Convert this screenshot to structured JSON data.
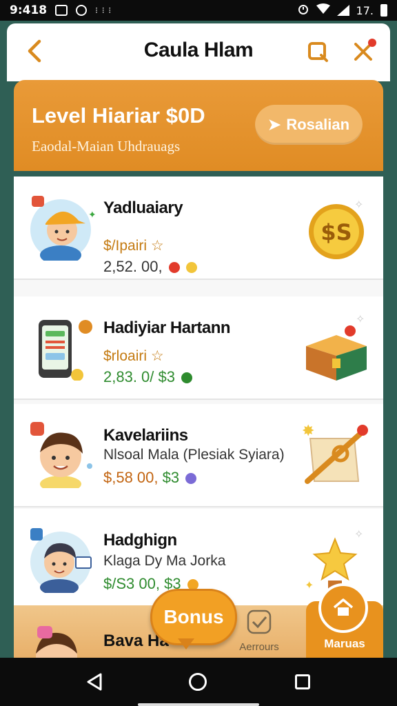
{
  "status_bar": {
    "time": "9:418",
    "dots": "⁝ ⁝ ⁝",
    "battery": "17."
  },
  "header": {
    "title": "Caula Hlam",
    "back_icon": "chevron-left-icon",
    "search_icon": "search-icon",
    "close_icon": "close-icon"
  },
  "banner": {
    "title": "Level Hiariar $0D",
    "subtitle": "Eaodal-Maian Uhdrauags",
    "button_label": "Rosalian"
  },
  "cards": [
    {
      "name": "Yadluaiary",
      "sub": "$/Ipairi ☆",
      "price": "2,52. 00,",
      "reward": "coin-icon",
      "coin_text": "$S"
    },
    {
      "name": "Hadiyiar Hartann",
      "sub": "$rloairi ☆",
      "price": "2,83. 0/",
      "price_suffix": "$3",
      "reward": "chest-icon"
    },
    {
      "name": "Kavelariins",
      "sub": "Nlsoal Mala (Plesiak Syiara)",
      "price": "$,58 00,",
      "price_suffix": "$3",
      "reward": "scroll-icon"
    },
    {
      "name": "Hadghign",
      "sub": "Klaga Dy Ma Jorka",
      "price": "$/S3 00,",
      "price_suffix": "$3",
      "reward": "star-trophy-icon"
    }
  ],
  "bottom": {
    "partial_name": "Bava Ha",
    "bonus_label": "Bonus",
    "nav_label_2": "Aerrours",
    "menu_label": "Maruas"
  },
  "colors": {
    "accent": "#e8921e",
    "background": "#2f5f55",
    "gold": "#d9a020",
    "green": "#2e8b2e"
  }
}
